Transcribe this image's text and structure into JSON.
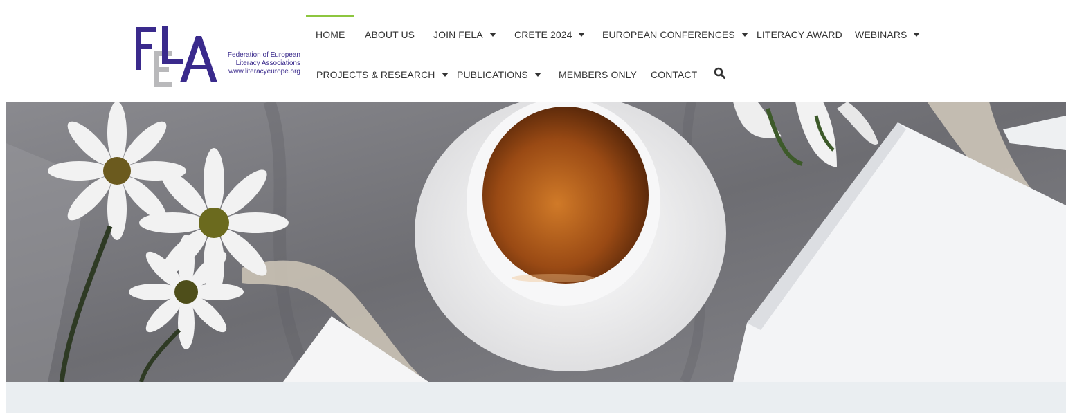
{
  "logo": {
    "letters": "FELA",
    "line1": "Federation of European",
    "line2": "Literacy Associations",
    "line3": "www.literacyeurope.org"
  },
  "nav": {
    "row1": [
      {
        "label": "HOME",
        "active": true,
        "dropdown": false
      },
      {
        "label": "ABOUT US",
        "dropdown": false
      },
      {
        "label": "JOIN FELA",
        "dropdown": true
      },
      {
        "label": "CRETE 2024",
        "dropdown": true
      },
      {
        "label": "EUROPEAN CONFERENCES",
        "dropdown": true
      },
      {
        "label": "LITERACY AWARD",
        "dropdown": false
      },
      {
        "label": "WEBINARS",
        "dropdown": true
      }
    ],
    "row2": [
      {
        "label": "PROJECTS & RESEARCH",
        "dropdown": true
      },
      {
        "label": "PUBLICATIONS",
        "dropdown": true
      },
      {
        "label": "MEMBERS ONLY",
        "dropdown": false
      },
      {
        "label": "CONTACT",
        "dropdown": false
      }
    ],
    "search_icon": "search-icon"
  },
  "colors": {
    "accent": "#8dc63f",
    "logo_purple": "#3a2a8c",
    "logo_gray": "#b9b9bb",
    "nav_text": "#333333",
    "band": "#eaeef1"
  },
  "hero": {
    "image": "tea-cup-daisies-book-photo"
  }
}
